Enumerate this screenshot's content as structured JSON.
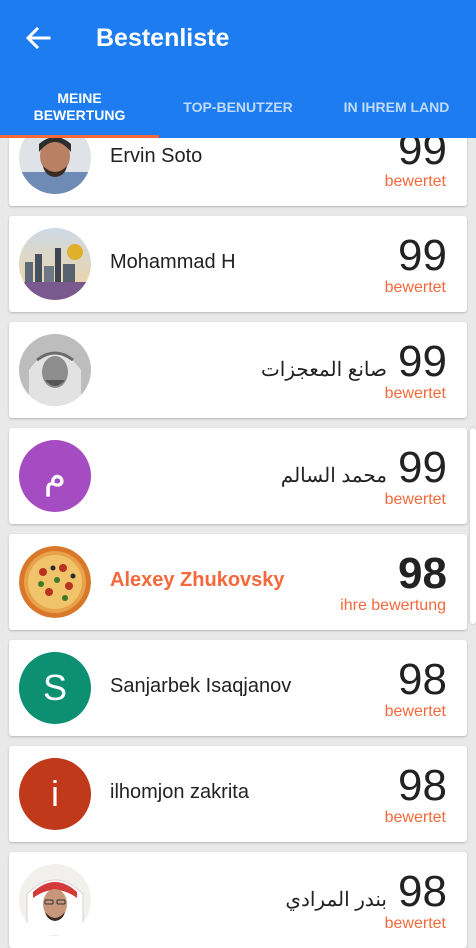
{
  "header": {
    "title": "Bestenliste",
    "back_icon": "arrow-left-icon"
  },
  "tabs": [
    {
      "label": "MEINE\nBEWERTUNG",
      "active": true
    },
    {
      "label": "TOP-BENUTZER",
      "active": false
    },
    {
      "label": "IN IHREM LAND",
      "active": false
    }
  ],
  "colors": {
    "primary": "#1c7cf0",
    "accent": "#f4683b"
  },
  "entries": [
    {
      "name": "Ervin Soto",
      "score": "99",
      "label": "bewertet",
      "avatar": "photo",
      "rtl": false,
      "me": false
    },
    {
      "name": "Mohammad H",
      "score": "99",
      "label": "bewertet",
      "avatar": "photo",
      "rtl": false,
      "me": false
    },
    {
      "name": "صانع المعجزات",
      "score": "99",
      "label": "bewertet",
      "avatar": "photo",
      "rtl": true,
      "me": false
    },
    {
      "name": "محمد السالم",
      "score": "99",
      "label": "bewertet",
      "avatar": "letter",
      "initial": "م",
      "avatar_color": "#a64cc3",
      "rtl": true,
      "me": false
    },
    {
      "name": "Alexey Zhukovsky",
      "score": "98",
      "label": "ihre bewertung",
      "avatar": "photo",
      "rtl": false,
      "me": true
    },
    {
      "name": "Sanjarbek Isaqjanov",
      "score": "98",
      "label": "bewertet",
      "avatar": "letter",
      "initial": "S",
      "avatar_color": "#0d8f72",
      "rtl": false,
      "me": false
    },
    {
      "name": "ilhomjon zakrita",
      "score": "98",
      "label": "bewertet",
      "avatar": "letter",
      "initial": "i",
      "avatar_color": "#c0391b",
      "rtl": false,
      "me": false
    },
    {
      "name": "بندر المرادي",
      "score": "98",
      "label": "bewertet",
      "avatar": "photo",
      "rtl": true,
      "me": false
    }
  ]
}
